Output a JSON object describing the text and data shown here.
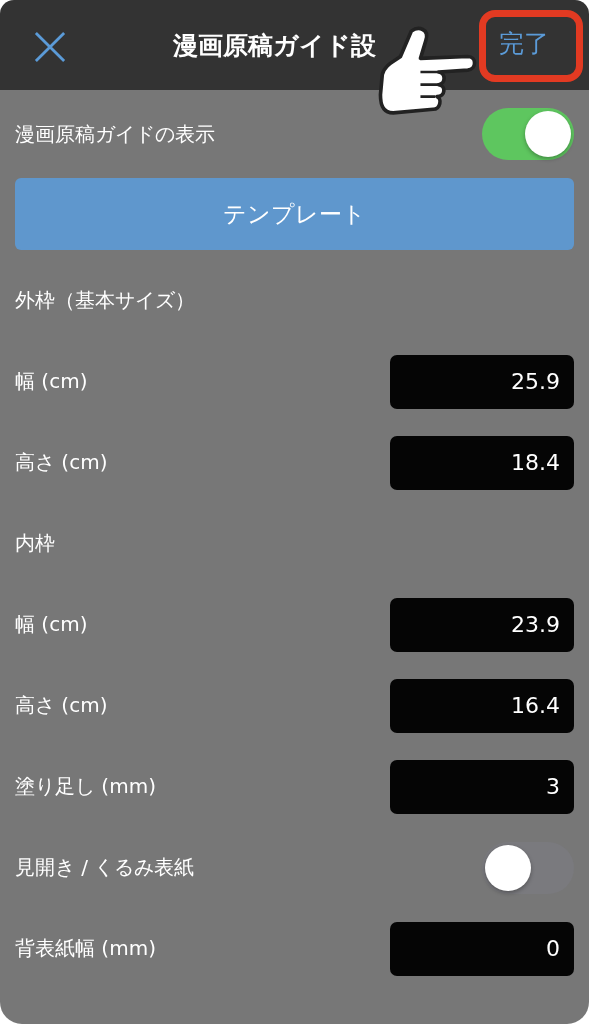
{
  "header": {
    "title": "漫画原稿ガイド設",
    "done": "完了",
    "done_highlighted": true
  },
  "guide_toggle": {
    "label": "漫画原稿ガイドの表示",
    "on": true
  },
  "template_button": "テンプレート",
  "rows": [
    {
      "kind": "section",
      "label": "外枠（基本サイズ）"
    },
    {
      "kind": "field",
      "label": "幅 (cm)",
      "value": "25.9"
    },
    {
      "kind": "field",
      "label": "高さ (cm)",
      "value": "18.4"
    },
    {
      "kind": "section",
      "label": "内枠"
    },
    {
      "kind": "field",
      "label": "幅 (cm)",
      "value": "23.9"
    },
    {
      "kind": "field",
      "label": "高さ (cm)",
      "value": "16.4"
    },
    {
      "kind": "field",
      "label": "塗り足し (mm)",
      "value": "3"
    },
    {
      "kind": "toggle",
      "label": "見開き / くるみ表紙",
      "on": false
    },
    {
      "kind": "field",
      "label": "背表紙幅 (mm)",
      "value": "0"
    }
  ]
}
